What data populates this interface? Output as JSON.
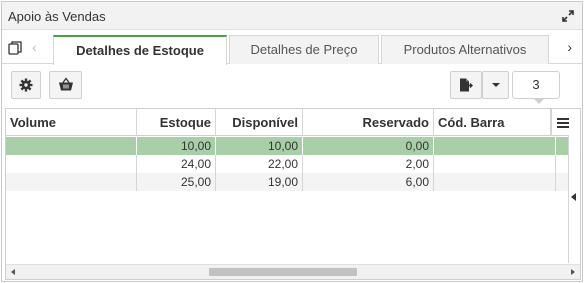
{
  "panel": {
    "title": "Apoio às Vendas"
  },
  "tabs": [
    {
      "label": "Detalhes de Estoque",
      "active": true
    },
    {
      "label": "Detalhes de Preço",
      "active": false
    },
    {
      "label": "Produtos Alternativos",
      "active": false
    }
  ],
  "toolbar": {
    "count": "3"
  },
  "grid": {
    "columns": [
      "Volume",
      "Estoque",
      "Disponível",
      "Reservado",
      "Cód. Barra"
    ],
    "rows": [
      {
        "volume": "",
        "estoque": "10,00",
        "disponivel": "10,00",
        "reservado": "0,00",
        "cod_barra": "",
        "selected": true
      },
      {
        "volume": "",
        "estoque": "24,00",
        "disponivel": "22,00",
        "reservado": "2,00",
        "cod_barra": ""
      },
      {
        "volume": "",
        "estoque": "25,00",
        "disponivel": "19,00",
        "reservado": "6,00",
        "cod_barra": ""
      }
    ]
  },
  "colors": {
    "accent": "#45a149",
    "selected_row": "#a8cfa8"
  },
  "icons": [
    "expand-icon",
    "copy-icon",
    "chevron-left-icon",
    "chevron-right-icon",
    "gear-icon",
    "basket-icon",
    "export-document-icon",
    "caret-down-icon",
    "column-menu-icon"
  ]
}
